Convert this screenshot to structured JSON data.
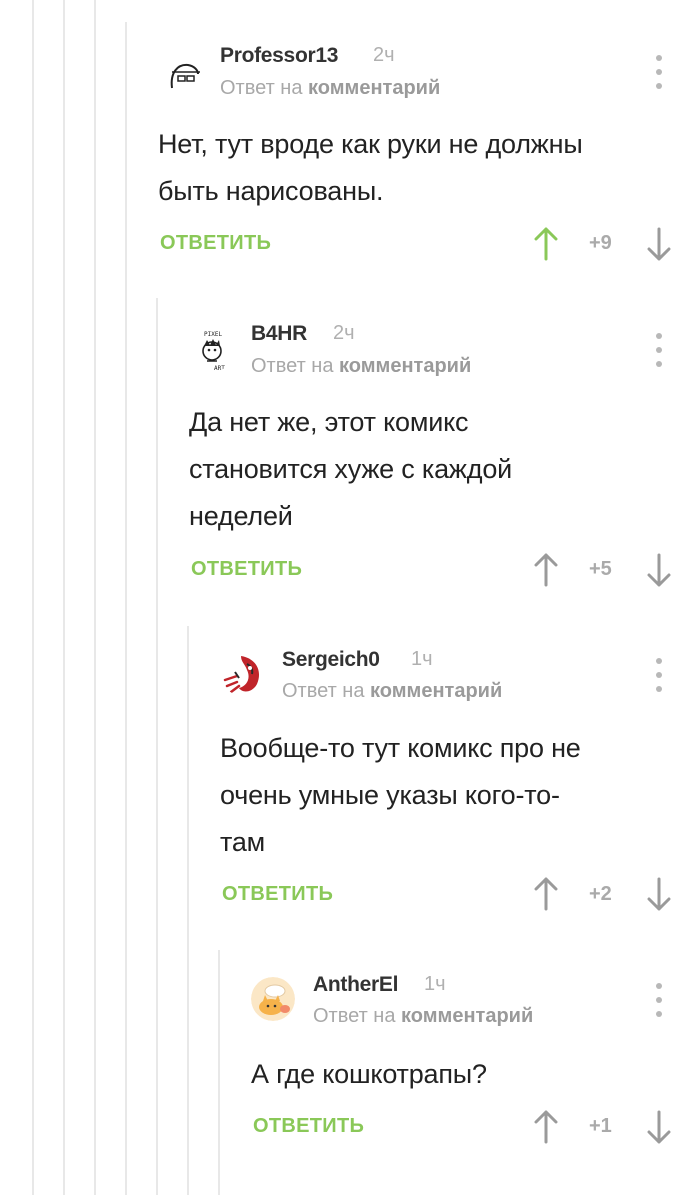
{
  "comments": [
    {
      "author": "Professor13",
      "time": "2ч",
      "reply_prefix": "Ответ на",
      "reply_target": "комментарий",
      "text_lines": [
        "Нет, тут вроде как руки не должны",
        "быть нарисованы."
      ],
      "reply_label": "ОТВЕТИТЬ",
      "score": "+9",
      "upvoted": true
    },
    {
      "author": "B4HR",
      "time": "2ч",
      "reply_prefix": "Ответ на",
      "reply_target": "комментарий",
      "text_lines": [
        "Да нет же, этот комикс",
        "становится хуже с каждой",
        "неделей"
      ],
      "reply_label": "ОТВЕТИТЬ",
      "score": "+5",
      "upvoted": false
    },
    {
      "author": "Sergeich0",
      "time": "1ч",
      "reply_prefix": "Ответ на",
      "reply_target": "комментарий",
      "text_lines": [
        "Вообще-то тут комикс про не",
        "очень умные указы кого-то-",
        "там"
      ],
      "reply_label": "ОТВЕТИТЬ",
      "score": "+2",
      "upvoted": false
    },
    {
      "author": "AntherEl",
      "time": "1ч",
      "reply_prefix": "Ответ на",
      "reply_target": "комментарий",
      "text_lines": [
        "А где кошкотрапы?"
      ],
      "reply_label": "ОТВЕТИТЬ",
      "score": "+1",
      "upvoted": false
    }
  ],
  "colors": {
    "accent_green": "#8ac858",
    "muted_gray": "#aaaaaa",
    "thread_line": "#e8e8e8"
  },
  "icons": {
    "upvote": "arrow-up-icon",
    "downvote": "arrow-down-icon",
    "menu": "more-vertical-icon"
  }
}
